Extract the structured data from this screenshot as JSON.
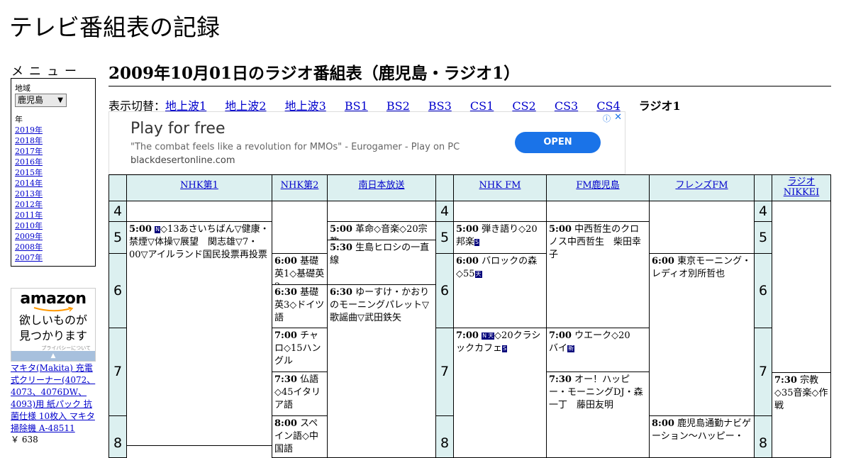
{
  "site_title": "テレビ番組表の記録",
  "menu": {
    "title": "メニュー",
    "region_label": "地域",
    "region_value": "鹿児島",
    "year_label": "年",
    "years": [
      "2019年",
      "2018年",
      "2017年",
      "2016年",
      "2015年",
      "2014年",
      "2013年",
      "2012年",
      "2011年",
      "2010年",
      "2009年",
      "2008年",
      "2007年"
    ]
  },
  "amazon": {
    "logo": "amazon",
    "tagline_1": "欲しいものが",
    "tagline_2": "見つかります",
    "privacy": "プライバシーについて",
    "product_name": "マキタ(Makita) 充電式クリーナー(4072、4073、4076DW、4093)用 紙パック 抗菌仕様 10枚入 マキタ 掃除機 A-48511",
    "product_price": "￥ 638"
  },
  "page_heading": "2009年10月01日のラジオ番組表（鹿児島・ラジオ1）",
  "switcher": {
    "label": "表示切替：",
    "links": [
      "地上波1",
      "地上波2",
      "地上波3",
      "BS1",
      "BS2",
      "BS3",
      "CS1",
      "CS2",
      "CS3",
      "CS4"
    ],
    "current": "ラジオ1"
  },
  "ad": {
    "title": "Play for free",
    "subtitle": "\"The combat feels like a revolution for MMOs\" - Eurogamer - Play on PC",
    "url": "blackdesertonline.com",
    "button": "OPEN",
    "info_icon": "ⓘ",
    "close_icon": "✕"
  },
  "channels": [
    "NHK第1",
    "NHK第2",
    "南日本放送",
    "NHK FM",
    "FM鹿児島",
    "フレンズFM",
    "ラジオNIKKEI"
  ],
  "hours": [
    "4",
    "5",
    "6",
    "7",
    "8"
  ],
  "programs": {
    "nhk1_500_time": "5:00",
    "nhk1_500_text": "◇13あさいちばん▽健康・禁煙▽体操▽展望　関志雄▽7・00▽アイルランド国民投票再投票",
    "nhk2_600_time": "6:00",
    "nhk2_600_text": "基礎英1◇基礎英2",
    "nhk2_630_time": "6:30",
    "nhk2_630_text": "基礎英3◇ドイツ語",
    "nhk2_700_time": "7:00",
    "nhk2_700_text": "チャロ◇15ハングル",
    "nhk2_730_time": "7:30",
    "nhk2_730_text": "仏語◇45イタリア語",
    "nhk2_800_time": "8:00",
    "nhk2_800_text": "スペイン語◇中国語",
    "mbc_500_time": "5:00",
    "mbc_500_text": "革命◇音楽◇20宗教",
    "mbc_530_time": "5:30",
    "mbc_530_text": "生島ヒロシの一直線",
    "mbc_630_time": "6:30",
    "mbc_630_text": "ゆーすけ・かおりのモーニングパレット▽歌謡曲▽武田鉄矢",
    "fm_500_time": "5:00",
    "fm_500_text": "弾き語り◇20邦楽",
    "fm_600_time": "6:00",
    "fm_600_text": "バロックの森◇55",
    "fm_700_time": "7:00",
    "fm_700_text": "◇20クラシックカフェ",
    "fmk_500_time": "5:00",
    "fmk_500_text": "中西哲生のクロノス中西哲生　柴田幸子",
    "fmk_700_time": "7:00",
    "fmk_700_text": "ウエーク◇20　バイ",
    "fmk_730_time": "7:30",
    "fmk_730_text": "オー！ハッピー・モーニングDJ・森一丁　藤田友明",
    "friends_600_time": "6:00",
    "friends_600_text": "東京モーニング・レディオ別所哲也",
    "friends_800_time": "8:00",
    "friends_800_text": "鹿児島通勤ナビゲーション～ハッピー・",
    "nikkei_730_time": "7:30",
    "nikkei_730_text": "宗教◇35音楽◇作戦"
  },
  "marks": {
    "n": "N",
    "stereo": "S",
    "new": "新",
    "ten": "天"
  }
}
